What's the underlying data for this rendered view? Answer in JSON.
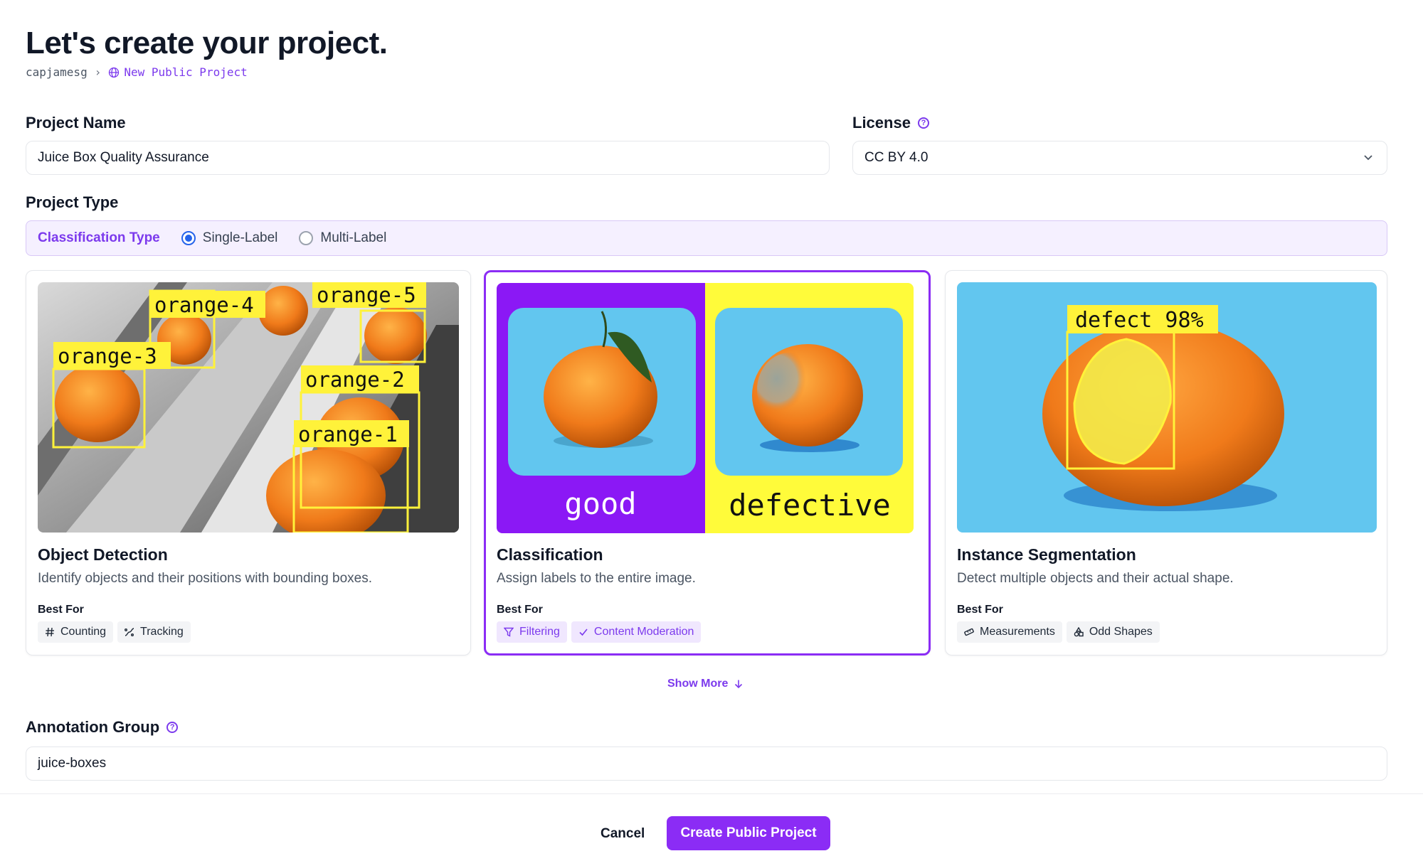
{
  "header": {
    "title": "Let's create your project.",
    "breadcrumb_user": "capjamesg",
    "breadcrumb_separator": "›",
    "breadcrumb_project": "New Public Project"
  },
  "form": {
    "project_name_label": "Project Name",
    "project_name_value": "Juice Box Quality Assurance",
    "license_label": "License",
    "license_value": "CC BY 4.0",
    "project_type_label": "Project Type",
    "classification_type_label": "Classification Type",
    "radio_options": [
      {
        "label": "Single-Label",
        "selected": true
      },
      {
        "label": "Multi-Label",
        "selected": false
      }
    ],
    "annotation_group_label": "Annotation Group",
    "annotation_group_value": "juice-boxes"
  },
  "cards": [
    {
      "title": "Object Detection",
      "description": "Identify objects and their positions with bounding boxes.",
      "best_for_label": "Best For",
      "selected": false,
      "tags": [
        {
          "label": "Counting",
          "icon": "hash-icon"
        },
        {
          "label": "Tracking",
          "icon": "tracking-icon"
        }
      ],
      "image_labels": [
        "orange-4",
        "orange-5",
        "orange-3",
        "orange-2",
        "orange-1"
      ]
    },
    {
      "title": "Classification",
      "description": "Assign labels to the entire image.",
      "best_for_label": "Best For",
      "selected": true,
      "tags": [
        {
          "label": "Filtering",
          "icon": "filter-icon"
        },
        {
          "label": "Content Moderation",
          "icon": "check-icon"
        }
      ],
      "image_labels": [
        "good",
        "defective"
      ]
    },
    {
      "title": "Instance Segmentation",
      "description": "Detect multiple objects and their actual shape.",
      "best_for_label": "Best For",
      "selected": false,
      "tags": [
        {
          "label": "Measurements",
          "icon": "ruler-icon"
        },
        {
          "label": "Odd Shapes",
          "icon": "shapes-icon"
        }
      ],
      "image_labels": [
        "defect 98%"
      ]
    }
  ],
  "show_more_label": "Show More",
  "footer": {
    "cancel_label": "Cancel",
    "create_label": "Create Public Project"
  },
  "colors": {
    "accent": "#8b2cf5",
    "accent_text": "#7c3aed",
    "radio_selected": "#2563eb",
    "box_yellow": "#fff23a",
    "thumb_sky": "#62c6ef",
    "orange": "#f07a1a"
  }
}
